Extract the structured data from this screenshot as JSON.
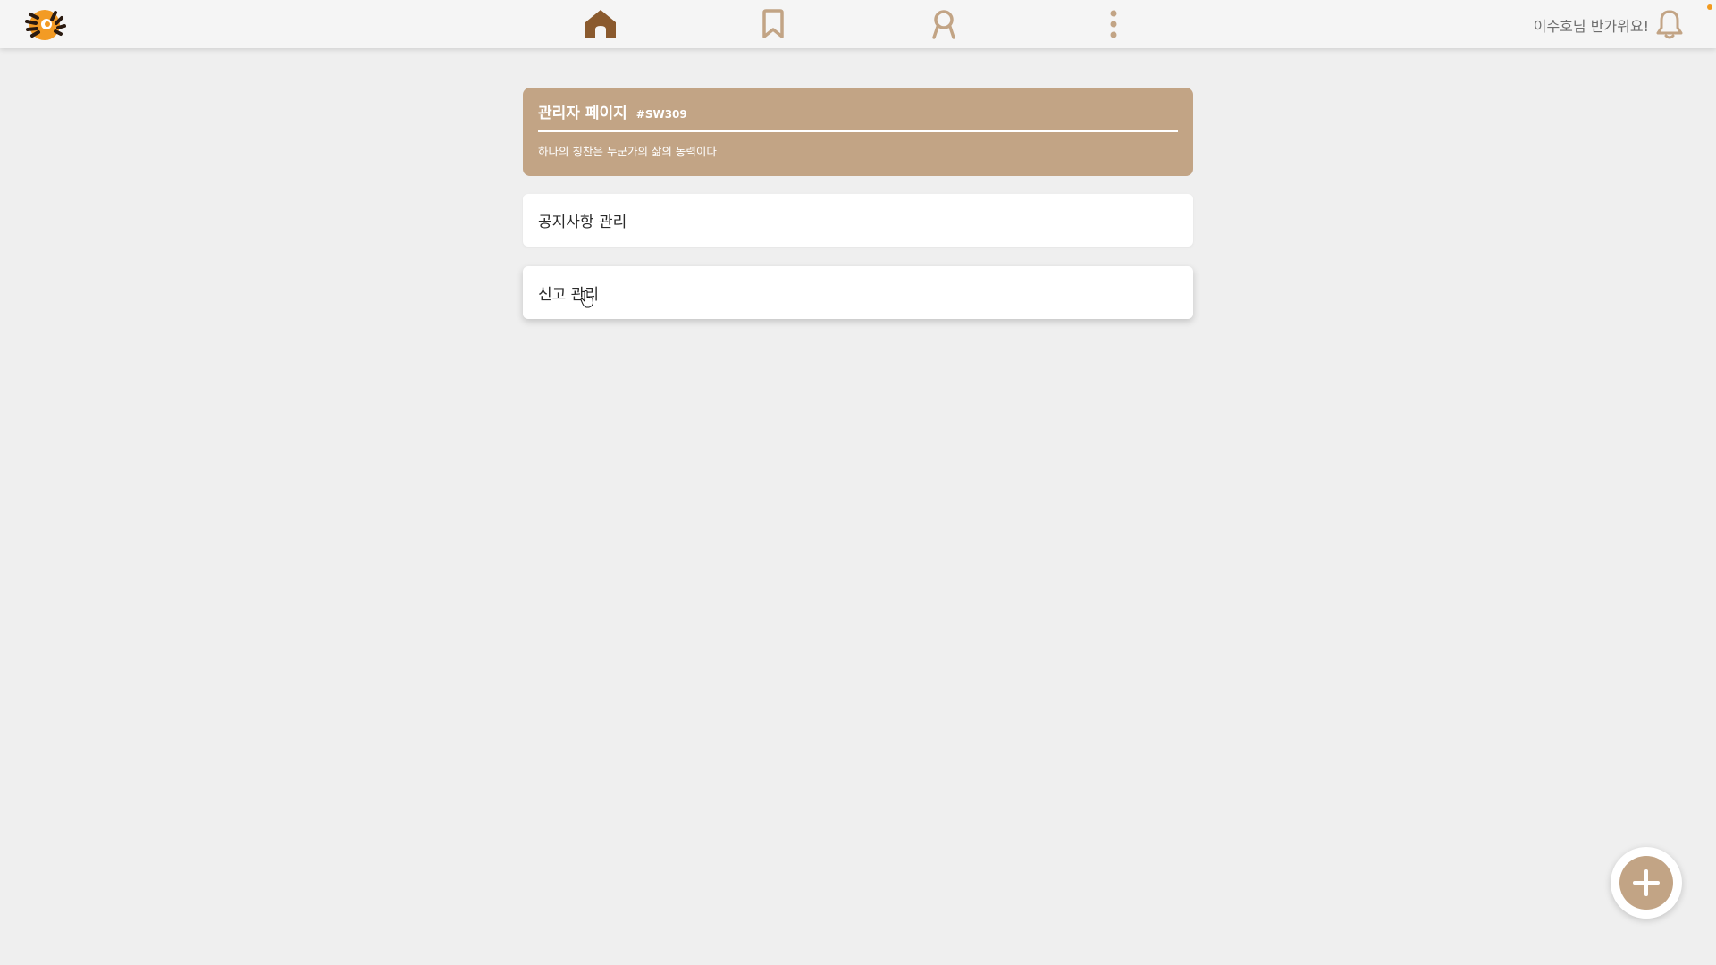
{
  "header": {
    "greeting": "이수호님 반가워요!",
    "icons": [
      "logo",
      "home-icon",
      "bookmark-icon",
      "profile-icon",
      "more-icon",
      "bell-icon"
    ]
  },
  "admin": {
    "title": "관리자 페이지",
    "code": "#SW309",
    "motto": "하나의 칭찬은 누군가의 삶의 동력이다"
  },
  "menu": {
    "notice_label": "공지사항 관리",
    "report_label": "신고 관리"
  },
  "colors": {
    "accent": "#c2a485",
    "nav_active": "#8a5a2e",
    "nav_inactive": "#c2a485",
    "notification_dot": "#f29a1f"
  }
}
